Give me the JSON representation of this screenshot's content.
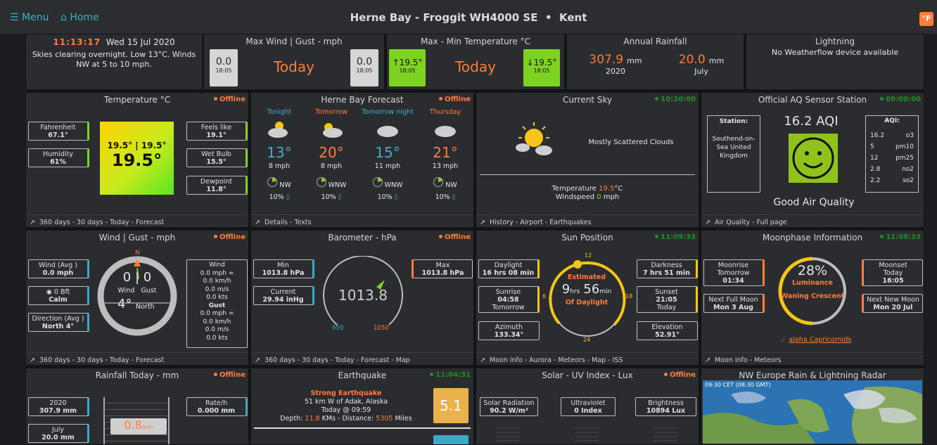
{
  "nav": {
    "menu": "Menu",
    "home": "Home",
    "title_station": "Herne Bay - Froggit WH4000 SE",
    "title_sep": "•",
    "title_region": "Kent",
    "unit": "°F"
  },
  "status": {
    "time": "11:13:17",
    "date": "Wed 15 Jul 2020",
    "forecast": "Skies clearing overnight. Low 13°C. Winds NW at 5 to 10 mph."
  },
  "maxwind": {
    "title": "Max Wind | Gust - mph",
    "left_val": "0.0",
    "left_time": "18:05",
    "center": "Today",
    "right_val": "0.0",
    "right_time": "18:05"
  },
  "maxmin": {
    "title": "Max - Min Temperature °C",
    "max": "↑19.5°",
    "max_time": "18:05",
    "center": "Today",
    "min": "↓19.5°",
    "min_time": "18:05"
  },
  "annual": {
    "title": "Annual Rainfall",
    "year_val": "307.9",
    "year_unit": "mm",
    "year": "2020",
    "month_val": "20.0",
    "month_unit": "mm",
    "month": "July"
  },
  "lightning": {
    "title": "Lightning",
    "msg": "No Weatherflow device available"
  },
  "temp": {
    "title": "Temperature °C",
    "status": "Offline",
    "f_label": "Fahrenheit",
    "f_val": "67.1°",
    "hum_label": "Humidity",
    "hum_val": "61%",
    "feels_label": "Feels like",
    "feels_val": "19.1°",
    "wet_label": "Wet Bulb",
    "wet_val": "15.5°",
    "dew_label": "Dewpoint",
    "dew_val": "11.8°",
    "hilo": "19.5° | 19.5°",
    "cur": "19.5°",
    "foot": "360 days  - 30 days  - Today  - Forecast"
  },
  "fc": {
    "title": "Herne Bay Forecast",
    "status": "Offline",
    "days": [
      {
        "name": "Tonight",
        "temp": "13°",
        "wind": "8 mph",
        "dir": "NW",
        "rain": "10%"
      },
      {
        "name": "Tomorrow",
        "temp": "20°",
        "wind": "8 mph",
        "dir": "WNW",
        "rain": "10%"
      },
      {
        "name": "Tomorrow night",
        "temp": "15°",
        "wind": "11 mph",
        "dir": "WNW",
        "rain": "10%"
      },
      {
        "name": "Thursday",
        "temp": "21°",
        "wind": "13 mph",
        "dir": "NW",
        "rain": "10%"
      }
    ],
    "foot": "Details  - Texts"
  },
  "sky": {
    "title": "Current Sky",
    "status": "10:20:00",
    "desc": "Mostly Scattered Clouds",
    "temp_label": "Temperature",
    "temp_val": "19.5",
    "temp_unit": "°C",
    "ws_label": "Windspeed",
    "ws_val": "0",
    "ws_unit": "mph",
    "foot": "History  - Airport  - Earthquakes"
  },
  "aq": {
    "title": "Official AQ Sensor Station",
    "status": "08:00:00",
    "station_label": "Station:",
    "station_name": "Southend-on-Sea United Kingdom",
    "aqi_value": "16.2 AQI",
    "quality": "Good Air Quality",
    "aqi_label": "AQI:",
    "pollutants": [
      {
        "v": "16.2",
        "n": "o3"
      },
      {
        "v": "5",
        "n": "pm10"
      },
      {
        "v": "12",
        "n": "pm25"
      },
      {
        "v": "2.8",
        "n": "no2"
      },
      {
        "v": "2.2",
        "n": "so2"
      }
    ],
    "foot": "Air Quality  - Full page"
  },
  "wind": {
    "title": "Wind | Gust - mph",
    "status": "Offline",
    "avg_label": "Wind (Avg )",
    "avg_val": "0.0 mph",
    "bft_label": "0 Bft",
    "bft_val": "Calm",
    "dir_label": "Direction (Avg )",
    "dir_val": "North 4°",
    "n": "N",
    "wind_val": "0",
    "gust_val": "0",
    "sep": "|",
    "wind_lbl": "Wind",
    "gust_lbl": "Gust",
    "deg": "4°",
    "dirname": "North",
    "r_wind": "Wind",
    "r_l1": "0.0 mph =",
    "r_l2": "0.0 km/h",
    "r_l3": "0.0 m/s",
    "r_l4": "0.0 kts",
    "r_gust": "Gust",
    "r_l5": "0.0 mph =",
    "r_l6": "0.0 km/h",
    "r_l7": "0.0 m/s",
    "r_l8": "0.0 kts",
    "foot": "360 days  - 30 days  - Today  - Forecast"
  },
  "baro": {
    "title": "Barometer - hPa",
    "status": "Offline",
    "min_label": "Min",
    "min_val": "1013.8 hPa",
    "cur_label": "Current",
    "cur_val": "29.94 inHg",
    "max_label": "Max",
    "max_val": "1013.8 hPa",
    "value": "1013.8",
    "low": "950",
    "high": "1050",
    "foot": "360 days  - 30 days  - Today  - Forecast  - Map"
  },
  "sun": {
    "title": "Sun Position",
    "status": "11:09:33",
    "day_label": "Daylight",
    "day_val": "16 hrs 08 min",
    "rise_label": "Sunrise",
    "rise_val": "04:58",
    "rise_day": "Tomorrow",
    "az_label": "Azimuth",
    "az_val": "133.34°",
    "dark_label": "Darkness",
    "dark_val": "7 hrs 51 min",
    "set_label": "Sunset",
    "set_val": "21:05",
    "set_day": "Today",
    "el_label": "Elevation",
    "el_val": "52.91°",
    "t12": "12",
    "t6": "6",
    "t18": "18",
    "t24": "24",
    "est": "Estimated",
    "hrs": "9",
    "hrs_u": "hrs",
    "mins": "56",
    "mins_u": "min",
    "of": "Of Daylight",
    "foot": "Moon info  - Aurora  - Meteors  - Map  - ISS"
  },
  "moon": {
    "title": "Moonphase Information",
    "status": "11:09:33",
    "rise_label": "Moonrise",
    "rise_day": "Tomorrow",
    "rise_val": "01:34",
    "full_label": "Next Full Moon",
    "full_val": "Mon 3 Aug",
    "set_label": "Moonset",
    "set_day": "Today",
    "set_val": "16:05",
    "new_label": "Next New Moon",
    "new_val": "Mon 20 Jul",
    "pct": "28%",
    "lum": "Luminance",
    "phase": "Waning Crescent",
    "meteor": "alpha Capricornids",
    "foot": "Moon info  - Meteors"
  },
  "rain": {
    "title": "Rainfall Today - mm",
    "status": "Offline",
    "y_label": "2020",
    "y_val": "307.9 mm",
    "m_label": "July",
    "m_val": "20.0 mm",
    "rate_label": "Rate/h",
    "rate_val": "0.000 mm",
    "today": "0.8",
    "unit": "mm"
  },
  "eq": {
    "title": "Earthquake",
    "status": "11:04:31",
    "head": "Strong Earthquake",
    "place": "51 km W of Adak, Alaska",
    "when": "Today @ 09:59",
    "depth_label": "Depth:",
    "depth": "11.8",
    "depth_unit": "KMs - Distance:",
    "dist": "5305",
    "dist_unit": "Miles",
    "mag": "5.1"
  },
  "solar": {
    "title": "Solar - UV Index - Lux",
    "status": "Offline",
    "sr_label": "Solar Radiation",
    "sr_val": "90.2 W/m²",
    "uv_label": "Ultraviolet",
    "uv_val": "0 Index",
    "br_label": "Brightness",
    "br_val": "10894 Lux"
  },
  "radar": {
    "title": "NW Europe Rain & Lightning Radar",
    "stamp": "09:30 CET (08:30 GMT)"
  }
}
